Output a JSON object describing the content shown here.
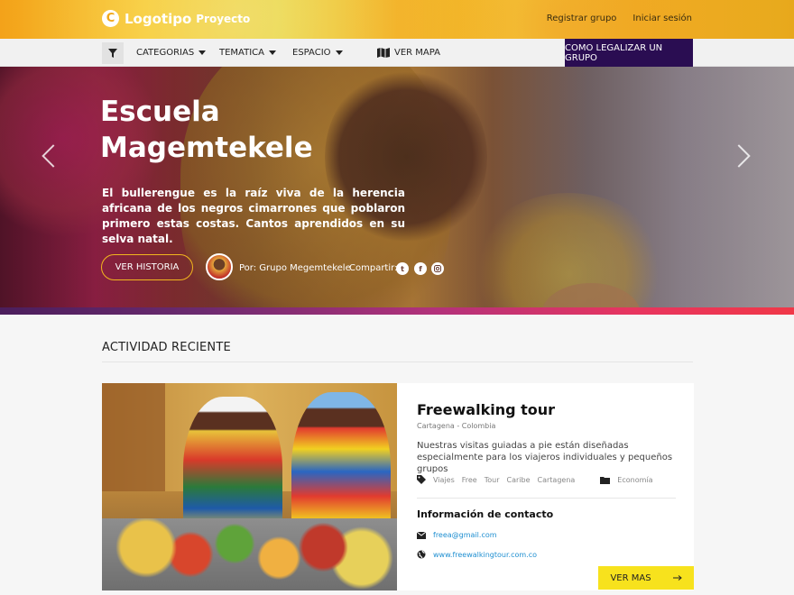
{
  "header": {
    "logo_mark": "C",
    "logo_text": "Logotipo",
    "logo_sub": "Proyecto",
    "register_label": "Registrar grupo",
    "login_label": "Iniciar sesión"
  },
  "nav": {
    "filter_icon": "filter-icon",
    "categories_label": "CATEGORIAS",
    "theme_label": "TEMATICA",
    "space_label": "ESPACIO",
    "map_label": "VER MAPA",
    "legal_label": "COMO LEGALIZAR UN GRUPO"
  },
  "hero": {
    "title": "Escuela Magemtekele",
    "description": "El bullerengue es la raíz viva de la herencia africana de los negros cimarrones que poblaron primero estas costas. Cantos aprendidos en su selva natal.",
    "story_label": "VER HISTORIA",
    "author_label": "Por: Grupo Megemtekele",
    "share_label": "Compartir:",
    "share_icons": [
      "twitter-icon",
      "facebook-icon",
      "instagram-icon"
    ]
  },
  "activity": {
    "section_title": "ACTIVIDAD RECIENTE",
    "card": {
      "title": "Freewalking tour",
      "location": "Cartagena - Colombia",
      "description": "Nuestras visitas guiadas a pie están diseñadas especialmente para los viajeros individuales y pequeños grupos",
      "tags": [
        "Viajes",
        "Free",
        "Tour",
        "Caribe",
        "Cartagena"
      ],
      "category": "Economía",
      "contact_title": "Información de contacto",
      "email": "freea@gmail.com",
      "website": "www.freewalkingtour.com.co",
      "more_label": "VER MAS"
    }
  },
  "colors": {
    "accent_yellow": "#f7e21d",
    "legal_button": "#2a0d52",
    "link_blue": "#1f8fd1"
  }
}
